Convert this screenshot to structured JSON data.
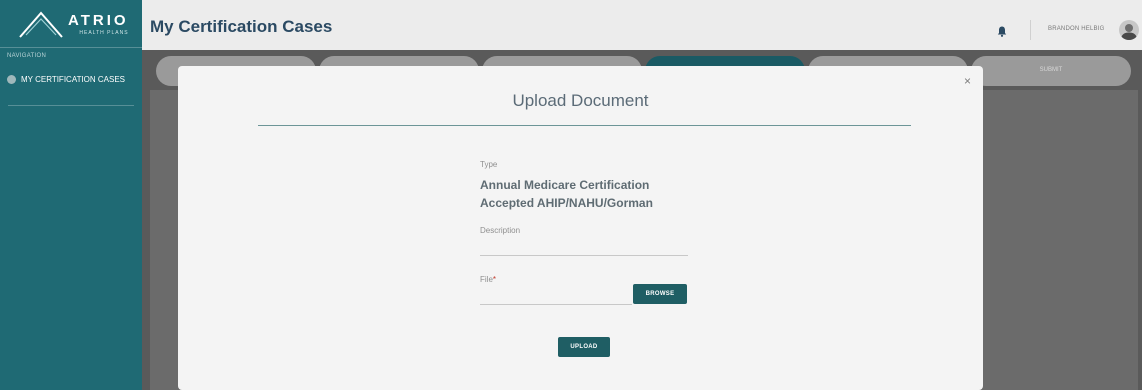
{
  "app": {
    "logo_text": "ATRIO",
    "logo_subtext": "HEALTH PLANS"
  },
  "sidebar": {
    "nav_label": "NAVIGATION",
    "items": [
      {
        "label": "MY CERTIFICATION CASES"
      }
    ]
  },
  "header": {
    "title": "My Certification Cases",
    "user_name": "BRANDON HELBIG"
  },
  "steps": {
    "last_label": "SUBMIT"
  },
  "modal": {
    "title": "Upload Document",
    "close_glyph": "×",
    "type_label": "Type",
    "type_value_line1": "Annual Medicare Certification",
    "type_value_line2": "Accepted AHIP/NAHU/Gorman",
    "description_label": "Description",
    "description_value": "",
    "file_label": "File",
    "file_required_marker": "*",
    "file_value": "",
    "browse_label": "BROWSE",
    "upload_label": "UPLOAD"
  },
  "colors": {
    "sidebar": "#1f6a74",
    "accent": "#1f5e64",
    "title": "#2b4a63",
    "overlay": "#5a5a5a"
  },
  "icons": [
    "atrio-logo-icon",
    "bell-icon",
    "avatar",
    "close-icon"
  ]
}
